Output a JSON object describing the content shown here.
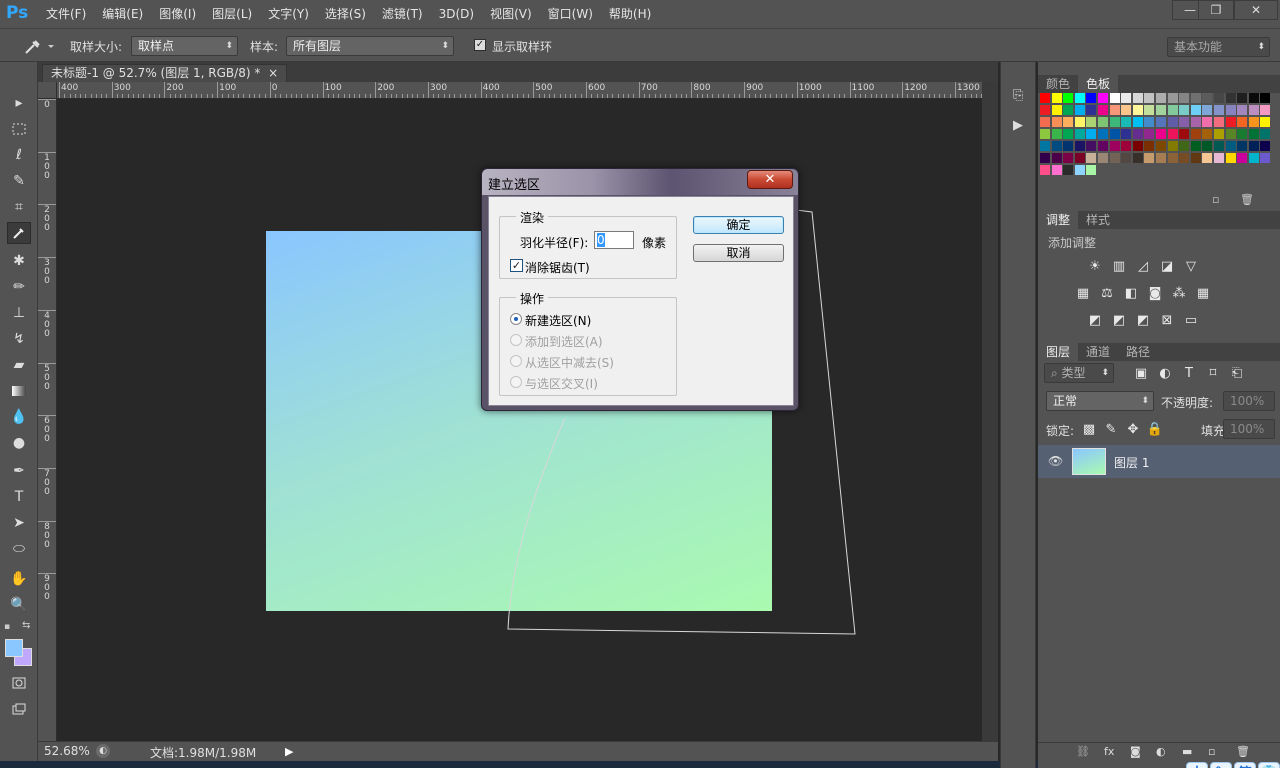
{
  "app": {
    "logo": "Ps",
    "accent": "#31a8ff"
  },
  "menu": [
    "文件(F)",
    "编辑(E)",
    "图像(I)",
    "图层(L)",
    "文字(Y)",
    "选择(S)",
    "滤镜(T)",
    "3D(D)",
    "视图(V)",
    "窗口(W)",
    "帮助(H)"
  ],
  "window_controls": {
    "minimize": "—",
    "restore": "❐",
    "close": "✕"
  },
  "options": {
    "sample_size_label": "取样大小:",
    "sample_size_value": "取样点",
    "sample_label": "样本:",
    "sample_value": "所有图层",
    "show_ring_label": "显示取样环",
    "show_ring_checked": true,
    "workspace": "基本功能"
  },
  "document": {
    "tab_title": "未标题-1 @ 52.7% (图层 1, RGB/8) *",
    "tab_close": "×",
    "gradient_colors": [
      "#8ac6ff",
      "#aafab0"
    ]
  },
  "ruler": {
    "h_labels": [
      "400",
      "300",
      "200",
      "100",
      "0",
      "100",
      "200",
      "300",
      "400",
      "500",
      "600",
      "700",
      "800",
      "900",
      "1000",
      "1100",
      "1200",
      "1300"
    ],
    "v_labels": [
      "0",
      "1 0 0",
      "2 0 0",
      "3 0 0",
      "4 0 0",
      "5 0 0",
      "6 0 0",
      "7 0 0",
      "8 0 0",
      "9 0 0"
    ]
  },
  "status": {
    "zoom": "52.68%",
    "doc": "文档:1.98M/1.98M"
  },
  "panels": {
    "color_tabs": [
      "颜色",
      "色板"
    ],
    "color_active": 1,
    "adjust_tabs": [
      "调整",
      "样式"
    ],
    "adjust_title": "添加调整",
    "layers_tabs": [
      "图层",
      "通道",
      "路径"
    ],
    "filter_kind": "类型",
    "blend_mode": "正常",
    "opacity_label": "不透明度:",
    "opacity_value": "100%",
    "lock_label": "锁定:",
    "fill_label": "填充:",
    "fill_value": "100%",
    "layer_name": "图层 1"
  },
  "swatches": [
    "#ff0000",
    "#ffff00",
    "#00ff00",
    "#00ffff",
    "#0000ff",
    "#ff00ff",
    "#ffffff",
    "#ebebeb",
    "#d6d6d6",
    "#c2c2c2",
    "#adadad",
    "#999999",
    "#858585",
    "#707070",
    "#5c5c5c",
    "#474747",
    "#333333",
    "#1f1f1f",
    "#0a0a0a",
    "#000000",
    "#ed1c24",
    "#fff200",
    "#00a651",
    "#00aeef",
    "#2e3192",
    "#ec008c",
    "#f7977a",
    "#fdc68a",
    "#fff79a",
    "#c4df9b",
    "#a3d39c",
    "#82ca9c",
    "#7accc8",
    "#6dcff6",
    "#7ea7d8",
    "#8493ca",
    "#8882be",
    "#a187be",
    "#bc8dbf",
    "#f49ac2",
    "#f26c4f",
    "#f68e55",
    "#fbaf5c",
    "#fff467",
    "#acd372",
    "#7dc473",
    "#3cb878",
    "#1abbb4",
    "#00bff3",
    "#438ccb",
    "#5574b9",
    "#605ca8",
    "#8560a8",
    "#a864a8",
    "#f06eaa",
    "#f26d7d",
    "#ed1c24",
    "#f26522",
    "#f7941d",
    "#fff200",
    "#8dc63f",
    "#39b54a",
    "#00a651",
    "#00a99d",
    "#00aeef",
    "#0072bc",
    "#0054a6",
    "#2e3192",
    "#662d91",
    "#92278f",
    "#ec008c",
    "#ed145b",
    "#9e0b0f",
    "#a0410d",
    "#a36209",
    "#aba000",
    "#598527",
    "#197b30",
    "#007236",
    "#00746b",
    "#0076a3",
    "#004b80",
    "#003471",
    "#1b1464",
    "#440e62",
    "#630460",
    "#9e005d",
    "#9e0039",
    "#790000",
    "#7b2e00",
    "#7d4900",
    "#827b00",
    "#406618",
    "#005e20",
    "#005826",
    "#005952",
    "#005b7f",
    "#003663",
    "#002157",
    "#0d004c",
    "#32004b",
    "#4b0049",
    "#7b0046",
    "#7a0026",
    "#c7b299",
    "#998675",
    "#736357",
    "#534741",
    "#37302a",
    "#c69c6d",
    "#a67c52",
    "#8c6239",
    "#754c24",
    "#603913",
    "#f6c594",
    "#e6b8d4",
    "#ffd600",
    "#c9009b",
    "#00b4cc",
    "#6a5acd",
    "#ff4f8b",
    "#ff6fcf",
    "#2b2b2b",
    "#8fd3ff",
    "#a8f5a8"
  ],
  "dialog": {
    "title": "建立选区",
    "render_group": "渲染",
    "feather_label": "羽化半径(F):",
    "feather_value": "0",
    "feather_unit": "像素",
    "antialias_label": "消除锯齿(T)",
    "antialias_checked": true,
    "operation_group": "操作",
    "op_new": "新建选区(N)",
    "op_add": "添加到选区(A)",
    "op_subtract": "从选区中减去(S)",
    "op_intersect": "与选区交叉(I)",
    "ok": "确定",
    "cancel": "取消"
  },
  "ime": [
    "中",
    "°,",
    "简",
    "👕"
  ]
}
